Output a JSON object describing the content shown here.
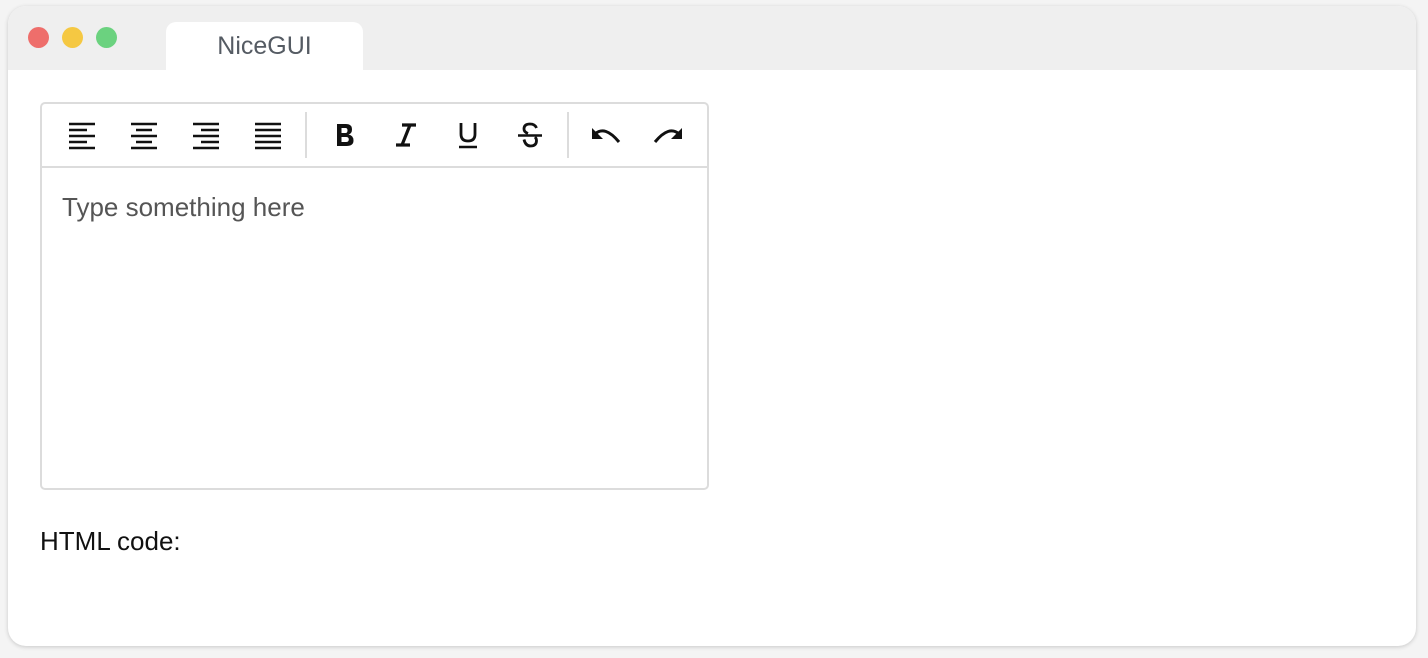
{
  "window": {
    "tab_title": "NiceGUI"
  },
  "editor": {
    "toolbar": [
      {
        "icon": "align-left-icon"
      },
      {
        "icon": "align-center-icon"
      },
      {
        "icon": "align-right-icon"
      },
      {
        "icon": "align-justify-icon"
      },
      {
        "icon": "bold-icon"
      },
      {
        "icon": "italic-icon"
      },
      {
        "icon": "underline-icon"
      },
      {
        "icon": "strikethrough-icon"
      },
      {
        "icon": "undo-icon"
      },
      {
        "icon": "redo-icon"
      }
    ],
    "placeholder": "Type something here"
  },
  "output": {
    "label": "HTML code:"
  },
  "colors": {
    "close": "#ee6e6b",
    "minimize": "#f5c842",
    "maximize": "#6bd27f",
    "titlebar": "#efefef"
  }
}
